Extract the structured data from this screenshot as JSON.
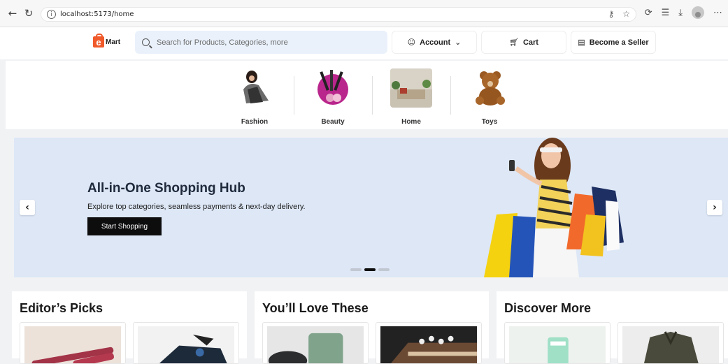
{
  "browser": {
    "url": "localhost:5173/home"
  },
  "header": {
    "logo_text": "Mart",
    "logo_letter": "e",
    "search_placeholder": "Search for Products, Categories, more",
    "account_label": "Account",
    "cart_label": "Cart",
    "seller_label": "Become a Seller"
  },
  "categories": [
    {
      "label": "Fashion",
      "icon": "fashion-icon"
    },
    {
      "label": "Beauty",
      "icon": "beauty-icon"
    },
    {
      "label": "Home",
      "icon": "home-icon"
    },
    {
      "label": "Toys",
      "icon": "toys-icon"
    }
  ],
  "hero": {
    "title": "All-in-One Shopping Hub",
    "subtitle": "Explore top categories, seamless payments & next-day delivery.",
    "cta_label": "Start Shopping",
    "slides_count": 3,
    "active_slide": 2
  },
  "sections": [
    {
      "title": "Editor’s Picks"
    },
    {
      "title": "You’ll Love These"
    },
    {
      "title": "Discover More"
    }
  ],
  "colors": {
    "brand": "#f0592a",
    "hero_bg": "#dde7f6",
    "search_bg": "#eaf1fb",
    "cta_bg": "#0d0d0d"
  }
}
